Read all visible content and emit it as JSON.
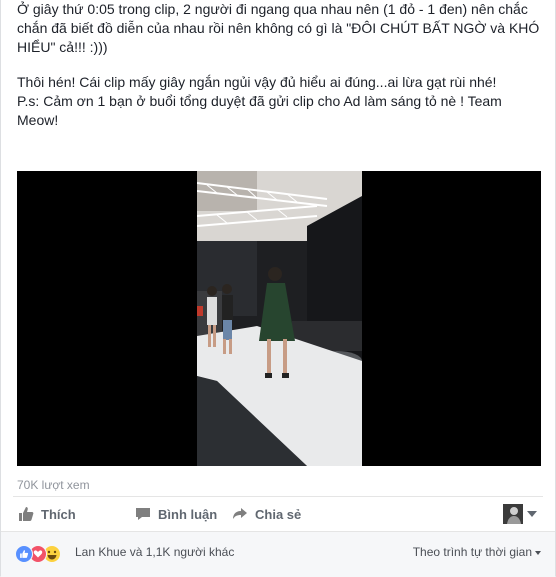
{
  "post": {
    "paragraphs": [
      "Ở giây thứ 0:05 trong clip, 2 người đi ngang qua nhau nên (1 đỏ - 1 đen) nên chắc chắn đã biết đồ diễn của nhau rồi nên không có gì là \"ĐÔI CHÚT BẤT NGỜ và KHÓ HIỂU\" cả!!! :)))",
      "Thôi hén! Cái clip mấy giây ngắn ngủi vậy đủ hiểu ai đúng...ai lừa gạt rùi nhé!",
      "P.s: Cảm ơn 1 bạn ở buổi tổng duyệt đã gửi clip cho Ad làm sáng tỏ nè ! Team Meow!"
    ]
  },
  "video": {
    "views_label": "70K lượt xem"
  },
  "actions": {
    "like": "Thích",
    "comment": "Bình luận",
    "share": "Chia sẻ"
  },
  "reactions": {
    "icons": [
      "like-reaction-icon",
      "love-reaction-icon",
      "haha-reaction-icon"
    ],
    "summary": "Lan Khue và 1,1K người khác",
    "sort_label": "Theo trình tự thời gian"
  },
  "colors": {
    "link": "#4b4f56",
    "like_blue": "#5890ff",
    "love_red": "#f25268",
    "haha_yellow": "#fcd13f"
  }
}
